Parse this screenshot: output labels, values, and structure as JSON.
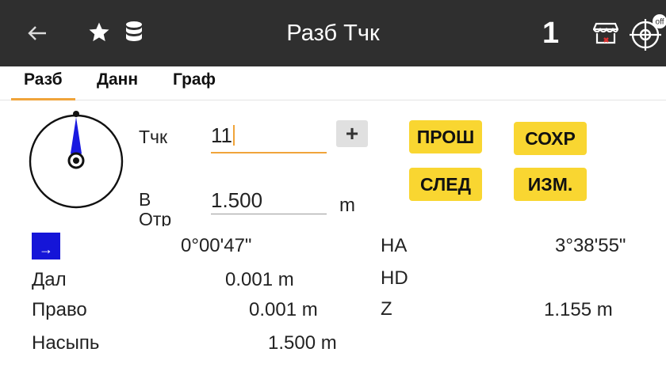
{
  "header": {
    "title": "Разб Тчк",
    "count": "1",
    "back_icon": "arrow-left-icon",
    "star_icon": "star-icon",
    "database_icon": "database-icon",
    "status_icon": "store-status-icon",
    "target_icon": "crosshair-target-icon",
    "target_badge": "off"
  },
  "tabs": [
    {
      "label": "Разб",
      "active": true
    },
    {
      "label": "Данн",
      "active": false
    },
    {
      "label": "Граф",
      "active": false
    }
  ],
  "form": {
    "point_label": "Тчк",
    "point_value": "11",
    "height_label": "В Отр",
    "height_value": "1.500",
    "height_unit": "m",
    "add_label": "+"
  },
  "buttons": {
    "prev": "ПРОШ",
    "save": "СОХР",
    "next": "СЛЕД",
    "edit": "ИЗМ."
  },
  "readings": {
    "direction_arrow": "→",
    "direction_value": "0°00'47\"",
    "ha_label": "HA",
    "ha_value": "3°38'55\"",
    "dist_label": "Дал",
    "dist_value": "0.001 m",
    "hd_label": "HD",
    "hd_value": "",
    "right_label": "Право",
    "right_value": "0.001 m",
    "z_label": "Z",
    "z_value": "1.155 m",
    "fill_label": "Насыпь",
    "fill_value": "1.500 m"
  },
  "colors": {
    "topbar": "#2f2f2f",
    "accent": "#f0a43a",
    "button_yellow": "#f9d631",
    "arrow_box": "#1515d8",
    "needle": "#1a1ae0"
  }
}
